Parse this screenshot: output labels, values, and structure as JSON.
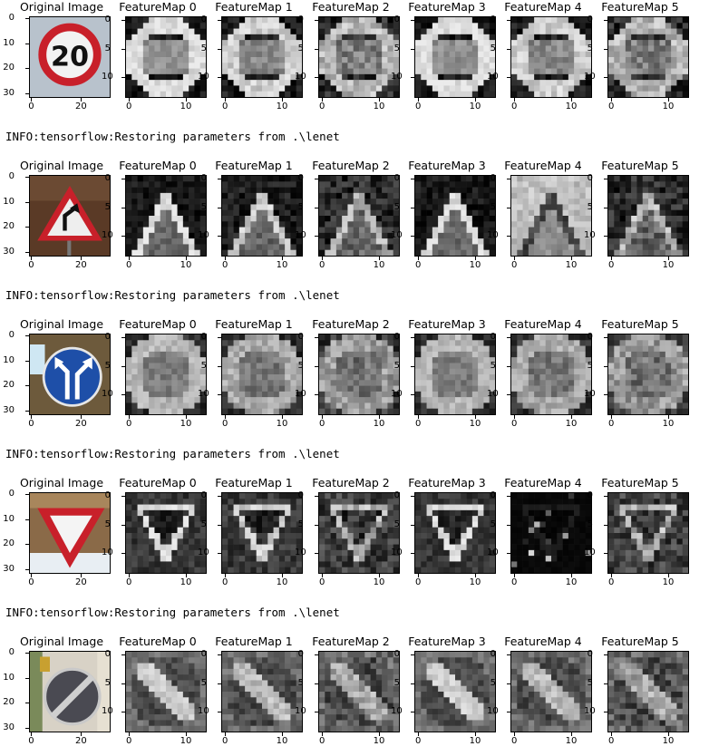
{
  "titles": {
    "original": "Original Image",
    "maps": [
      "FeatureMap 0",
      "FeatureMap 1",
      "FeatureMap 2",
      "FeatureMap 3",
      "FeatureMap 4",
      "FeatureMap 5"
    ]
  },
  "axis": {
    "orig_y_ticks": [
      "0",
      "10",
      "20",
      "30"
    ],
    "orig_x_ticks": [
      "0",
      "20"
    ],
    "map_y_ticks": [
      "0",
      "5",
      "10"
    ],
    "map_x_ticks": [
      "0",
      "10"
    ]
  },
  "log_lines": [
    "INFO:tensorflow:Restoring parameters from .\\lenet",
    "INFO:tensorflow:Restoring parameters from .\\lenet",
    "INFO:tensorflow:Restoring parameters from .\\lenet",
    "INFO:tensorflow:Restoring parameters from .\\lenet"
  ],
  "signs": [
    {
      "label": "20"
    },
    {
      "label": ""
    },
    {
      "label": ""
    },
    {
      "label": ""
    },
    {
      "label": ""
    }
  ],
  "colors": {
    "red": "#c8202a",
    "blue": "#1e4fa8",
    "bg_text": "#000000"
  }
}
